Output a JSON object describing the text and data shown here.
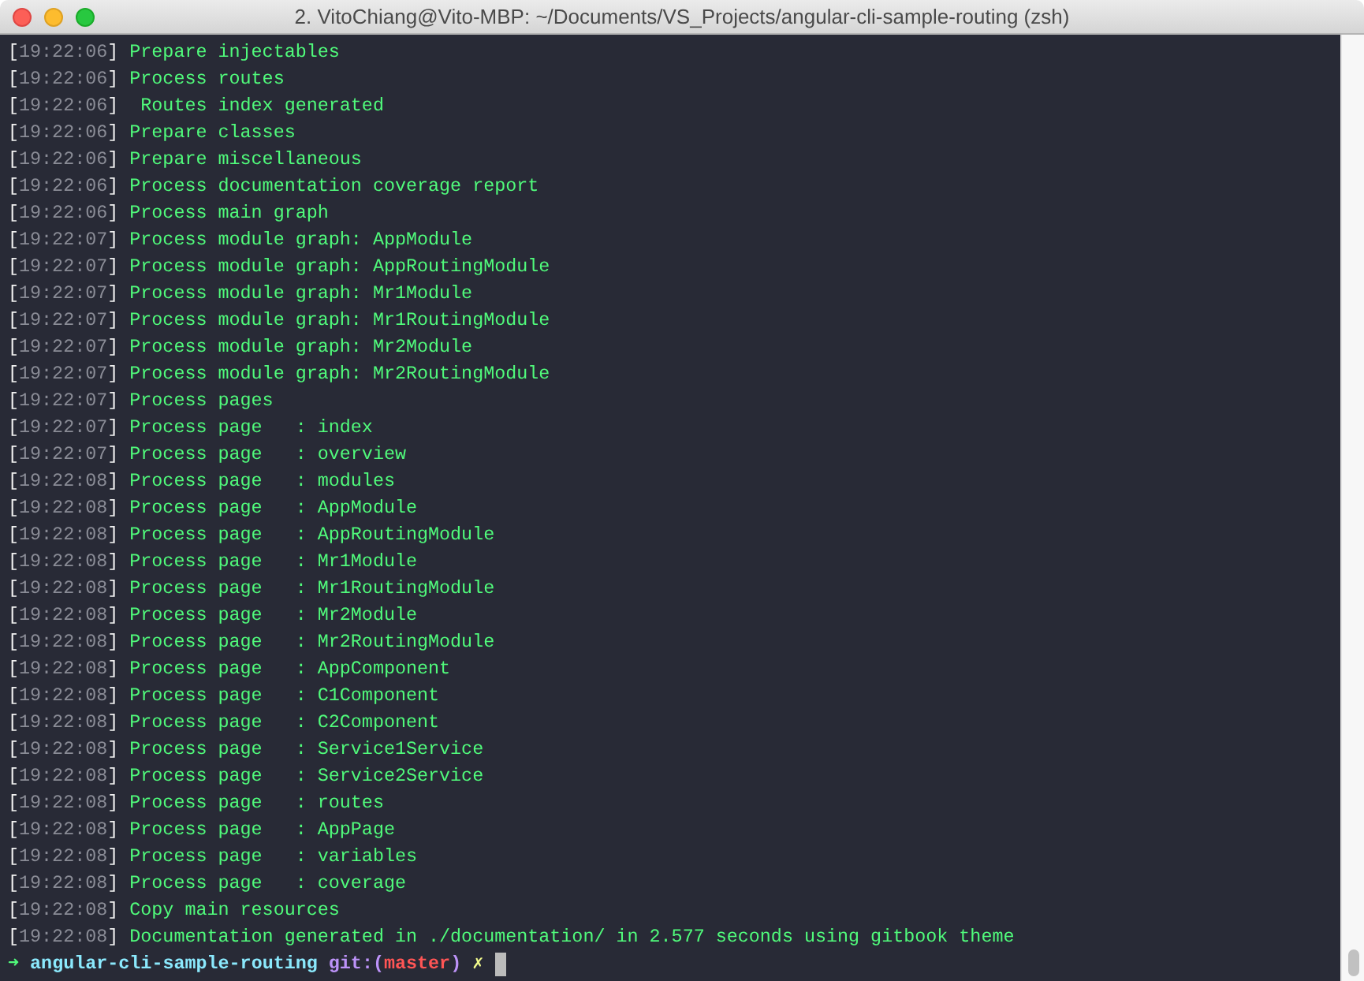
{
  "window": {
    "title": "2. VitoChiang@Vito-MBP: ~/Documents/VS_Projects/angular-cli-sample-routing (zsh)"
  },
  "lines": [
    {
      "time": "[19:22:06]",
      "message": "Prepare injectables"
    },
    {
      "time": "[19:22:06]",
      "message": "Process routes"
    },
    {
      "time": "[19:22:06]",
      "message": " Routes index generated"
    },
    {
      "time": "[19:22:06]",
      "message": "Prepare classes"
    },
    {
      "time": "[19:22:06]",
      "message": "Prepare miscellaneous"
    },
    {
      "time": "[19:22:06]",
      "message": "Process documentation coverage report"
    },
    {
      "time": "[19:22:06]",
      "message": "Process main graph"
    },
    {
      "time": "[19:22:07]",
      "message": "Process module graph: AppModule"
    },
    {
      "time": "[19:22:07]",
      "message": "Process module graph: AppRoutingModule"
    },
    {
      "time": "[19:22:07]",
      "message": "Process module graph: Mr1Module"
    },
    {
      "time": "[19:22:07]",
      "message": "Process module graph: Mr1RoutingModule"
    },
    {
      "time": "[19:22:07]",
      "message": "Process module graph: Mr2Module"
    },
    {
      "time": "[19:22:07]",
      "message": "Process module graph: Mr2RoutingModule"
    },
    {
      "time": "[19:22:07]",
      "message": "Process pages"
    },
    {
      "time": "[19:22:07]",
      "message": "Process page   : index"
    },
    {
      "time": "[19:22:07]",
      "message": "Process page   : overview"
    },
    {
      "time": "[19:22:08]",
      "message": "Process page   : modules"
    },
    {
      "time": "[19:22:08]",
      "message": "Process page   : AppModule"
    },
    {
      "time": "[19:22:08]",
      "message": "Process page   : AppRoutingModule"
    },
    {
      "time": "[19:22:08]",
      "message": "Process page   : Mr1Module"
    },
    {
      "time": "[19:22:08]",
      "message": "Process page   : Mr1RoutingModule"
    },
    {
      "time": "[19:22:08]",
      "message": "Process page   : Mr2Module"
    },
    {
      "time": "[19:22:08]",
      "message": "Process page   : Mr2RoutingModule"
    },
    {
      "time": "[19:22:08]",
      "message": "Process page   : AppComponent"
    },
    {
      "time": "[19:22:08]",
      "message": "Process page   : C1Component"
    },
    {
      "time": "[19:22:08]",
      "message": "Process page   : C2Component"
    },
    {
      "time": "[19:22:08]",
      "message": "Process page   : Service1Service"
    },
    {
      "time": "[19:22:08]",
      "message": "Process page   : Service2Service"
    },
    {
      "time": "[19:22:08]",
      "message": "Process page   : routes"
    },
    {
      "time": "[19:22:08]",
      "message": "Process page   : AppPage"
    },
    {
      "time": "[19:22:08]",
      "message": "Process page   : variables"
    },
    {
      "time": "[19:22:08]",
      "message": "Process page   : coverage"
    },
    {
      "time": "[19:22:08]",
      "message": "Copy main resources"
    },
    {
      "time": "[19:22:08]",
      "message": "Documentation generated in ./documentation/ in 2.577 seconds using gitbook theme"
    }
  ],
  "prompt": {
    "arrow": "➜",
    "directory": "angular-cli-sample-routing",
    "git_prefix": "git:(",
    "branch": "master",
    "git_suffix": ")",
    "dirty_mark": "✗"
  }
}
